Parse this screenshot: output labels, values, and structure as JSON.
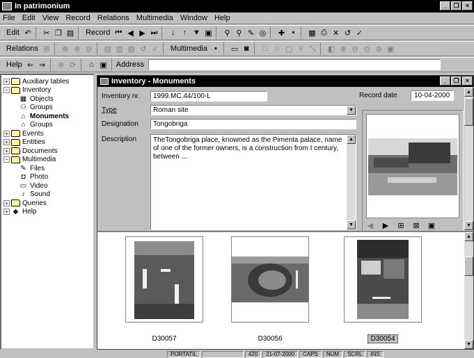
{
  "app": {
    "title": "In patrimonium"
  },
  "menu": [
    "File",
    "Edit",
    "View",
    "Record",
    "Relations",
    "Multimedia",
    "Window",
    "Help"
  ],
  "toolbar1": {
    "edit_label": "Edit",
    "record_label": "Record"
  },
  "toolbar2": {
    "relations_label": "Relations",
    "multimedia_label": "Multimedia"
  },
  "toolbar3": {
    "help_label": "Help",
    "address_label": "Address",
    "address_value": ""
  },
  "tree": [
    {
      "label": "Auxiliary tables",
      "pm": "+",
      "indent": 0,
      "icon": "folder"
    },
    {
      "label": "Inventory",
      "pm": "−",
      "indent": 0,
      "icon": "folder"
    },
    {
      "label": "Objects",
      "pm": "",
      "indent": 1,
      "icon": "▦"
    },
    {
      "label": "Groups",
      "pm": "",
      "indent": 1,
      "icon": "⚇"
    },
    {
      "label": "Monuments",
      "pm": "",
      "indent": 1,
      "icon": "⌂",
      "bold": true
    },
    {
      "label": "Groups",
      "pm": "",
      "indent": 1,
      "icon": "⌂"
    },
    {
      "label": "Events",
      "pm": "+",
      "indent": 0,
      "icon": "folder"
    },
    {
      "label": "Entities",
      "pm": "+",
      "indent": 0,
      "icon": "folder"
    },
    {
      "label": "Documents",
      "pm": "+",
      "indent": 0,
      "icon": "folder"
    },
    {
      "label": "Multimedia",
      "pm": "−",
      "indent": 0,
      "icon": "folder"
    },
    {
      "label": "Files",
      "pm": "",
      "indent": 1,
      "icon": "✎"
    },
    {
      "label": "Photo",
      "pm": "",
      "indent": 1,
      "icon": "◘"
    },
    {
      "label": "Video",
      "pm": "",
      "indent": 1,
      "icon": "▭"
    },
    {
      "label": "Sound",
      "pm": "",
      "indent": 1,
      "icon": "♪"
    },
    {
      "label": "Queries",
      "pm": "+",
      "indent": 0,
      "icon": "folder"
    },
    {
      "label": "Help",
      "pm": "+",
      "indent": 0,
      "icon": "◆"
    }
  ],
  "child": {
    "title": "Inventory - Monuments",
    "fields": {
      "inventory_label": "Inventory nr.",
      "inventory_value": "1999.MC.44/100-L",
      "type_label": "Type",
      "type_value": "Roman site",
      "designation_label": "Designation",
      "designation_value": "Tongobriga",
      "description_label": "Description",
      "description_value": "TheTongobriga place, knowned as the Pimenta palace, name of one of the former owners, is a construction from I century, between ...",
      "record_date_label": "Record date",
      "record_date_value": "10-04-2000"
    }
  },
  "thumbnails": [
    {
      "label": "D30057",
      "selected": false
    },
    {
      "label": "D30056",
      "selected": false
    },
    {
      "label": "D30054",
      "selected": true
    }
  ],
  "status": [
    "PORTATIL",
    "",
    "420",
    "21-07-2000",
    "CAPS",
    "NUM",
    "SCRL",
    "INS"
  ]
}
